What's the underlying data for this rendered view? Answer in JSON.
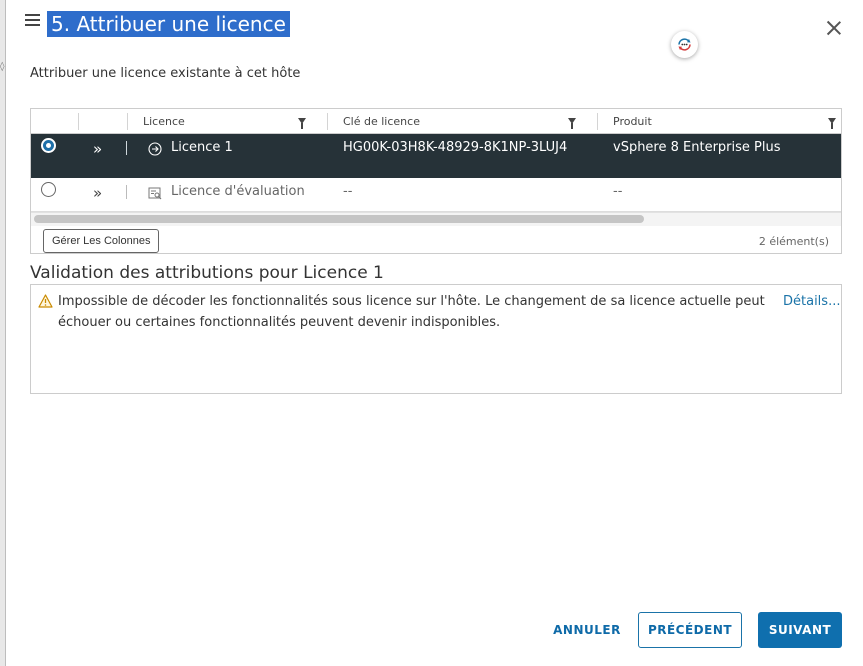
{
  "dialog": {
    "title": "5. Attribuer une licence",
    "subtitle": "Attribuer une licence existante à cet hôte"
  },
  "grid": {
    "columns": [
      "Licence",
      "Clé de licence",
      "Produit"
    ],
    "rows": [
      {
        "selected": true,
        "licence": "Licence 1",
        "key": "HG00K-03H8K-48929-8K1NP-3LUJ4",
        "product": "vSphere 8 Enterprise Plus"
      },
      {
        "selected": false,
        "licence": "Licence d'évaluation",
        "key": "--",
        "product": "--"
      }
    ],
    "manage_columns_label": "Gérer Les Colonnes",
    "count_label": "2 élément(s)"
  },
  "validation": {
    "title": "Validation des attributions pour Licence 1",
    "message": "Impossible de décoder les fonctionnalités sous licence sur l'hôte. Le changement de sa licence actuelle peut échouer ou certaines fonctionnalités peuvent devenir indisponibles.",
    "details_label": "Détails..."
  },
  "footer": {
    "cancel_label": "ANNULER",
    "previous_label": "PRÉCÉDENT",
    "next_label": "SUIVANT"
  },
  "colors": {
    "title_highlight": "#2e6dcb",
    "selected_row": "#263238",
    "primary": "#0f6fae",
    "warning": "#c98a00"
  },
  "icons": {
    "menu": "hamburger-icon",
    "close": "close-icon",
    "sync": "sync-icon",
    "expand": "double-chevron-right-icon",
    "licence": "license-key-icon",
    "evaluation": "license-evaluation-icon",
    "filter": "filter-icon",
    "warning": "warning-triangle-icon"
  }
}
